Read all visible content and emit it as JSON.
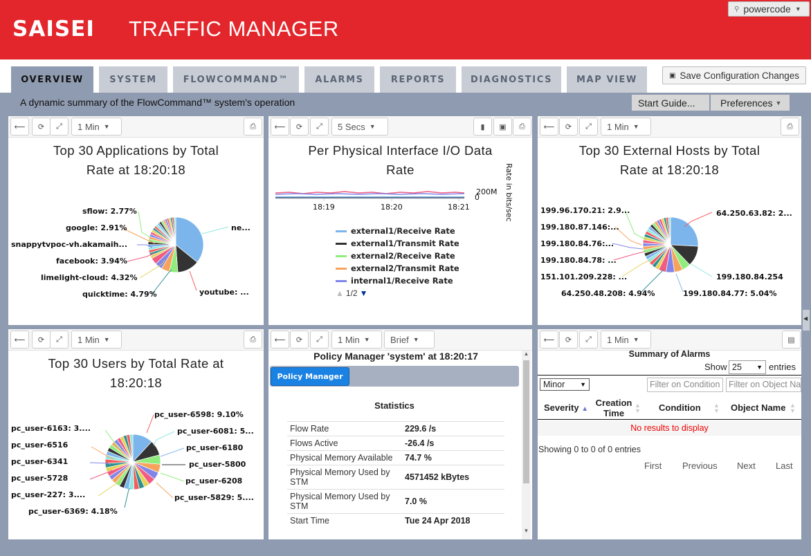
{
  "app": {
    "logo": "SAISEI",
    "title": "TRAFFIC MANAGER",
    "user": "powercode"
  },
  "tabs": [
    {
      "label": "OVERVIEW"
    },
    {
      "label": "SYSTEM"
    },
    {
      "label": "FLOWCOMMAND™"
    },
    {
      "label": "ALARMS"
    },
    {
      "label": "REPORTS"
    },
    {
      "label": "DIAGNOSTICS"
    },
    {
      "label": "MAP VIEW"
    }
  ],
  "save_button": "Save Configuration Changes",
  "summary": "A dynamic summary of the FlowCommand™ system's operation",
  "start_guide": "Start Guide...",
  "preferences": "Preferences",
  "panels": {
    "apps": {
      "interval": "1 Min",
      "title1": "Top 30 Applications by Total",
      "title2": "Rate at 18:20:18",
      "labels": [
        "sflow: 2.77%",
        "google: 2.91%",
        "snappytvpoc-vh.akamaih...",
        "facebook: 3.94%",
        "limelight-cloud: 4.32%",
        "quicktime: 4.79%",
        "youtube: ...",
        "ne..."
      ]
    },
    "io": {
      "interval": "5 Secs",
      "title1": "Per Physical Interface I/O Data",
      "title2": "Rate",
      "ytick_top": "200M",
      "ytick_bottom": "0",
      "ylabel": "Rate in bits/sec",
      "xticks": [
        "18:19",
        "18:20",
        "18:21"
      ],
      "legend": [
        {
          "name": "external1/Receive Rate",
          "color": "#7cb5ec"
        },
        {
          "name": "external1/Transmit Rate",
          "color": "#333333"
        },
        {
          "name": "external2/Receive Rate",
          "color": "#90ed7d"
        },
        {
          "name": "external2/Transmit Rate",
          "color": "#f7a35c"
        },
        {
          "name": "internal1/Receive Rate",
          "color": "#8085e9"
        }
      ],
      "legend_page": "1/2"
    },
    "hosts": {
      "interval": "1 Min",
      "title1": "Top 30 External Hosts by Total",
      "title2": "Rate at 18:20:18",
      "labels": [
        "199.96.170.21: 2.9...",
        "199.180.87.146:...",
        "199.180.84.76:...",
        "199.180.84.78: ...",
        "151.101.209.228: ...",
        "64.250.48.208: 4.94%",
        "64.250.63.82: 2...",
        "199.180.84.254",
        "199.180.84.77: 5.04%"
      ]
    },
    "users": {
      "interval": "1 Min",
      "title1": "Top 30 Users by Total Rate at",
      "title2": "18:20:18",
      "labels": [
        "pc_user-6163: 3....",
        "pc_user-6516",
        "pc_user-6341",
        "pc_user-5728",
        "pc_user-227: 3....",
        "pc_user-6369: 4.18%",
        "pc_user-6598: 9.10%",
        "pc_user-6081: 5...",
        "pc_user-6180",
        "pc_user-5800",
        "pc_user-6208",
        "pc_user-5829: 5...."
      ]
    },
    "policy": {
      "interval": "1 Min",
      "mode": "Brief",
      "title": "Policy Manager 'system' at 18:20:17",
      "tab": "Policy Manager",
      "stats_title": "Statistics",
      "rows": [
        {
          "k": "Flow Rate",
          "v": "229.6 /s"
        },
        {
          "k": "Flows Active",
          "v": "-26.4 /s"
        },
        {
          "k": "Physical Memory Available",
          "v": "74.7 %"
        },
        {
          "k": "Physical Memory Used by STM",
          "v": "4571452 kBytes"
        },
        {
          "k": "Physical Memory Used by STM",
          "v": "7.0 %"
        },
        {
          "k": "Start Time",
          "v": "Tue 24 Apr 2018"
        }
      ]
    },
    "alarms": {
      "interval": "1 Min",
      "title": "Summary of Alarms",
      "show": "Show",
      "entries_count": "25",
      "entries": "entries",
      "severity_filter": "Minor",
      "filter_condition": "Filter on Condition",
      "filter_object": "Filter on Object Na",
      "columns": [
        "Severity",
        "Creation Time",
        "Condition",
        "Object Name"
      ],
      "no_results": "No results to display",
      "info": "Showing 0 to 0 of 0 entries",
      "pager": [
        "First",
        "Previous",
        "Next",
        "Last"
      ]
    }
  },
  "pie_colors": [
    "#7cb5ec",
    "#333333",
    "#90ed7d",
    "#f7a35c",
    "#8085e9",
    "#f15c80",
    "#e4d354",
    "#2b908f",
    "#f45b5b",
    "#91e8e1"
  ]
}
